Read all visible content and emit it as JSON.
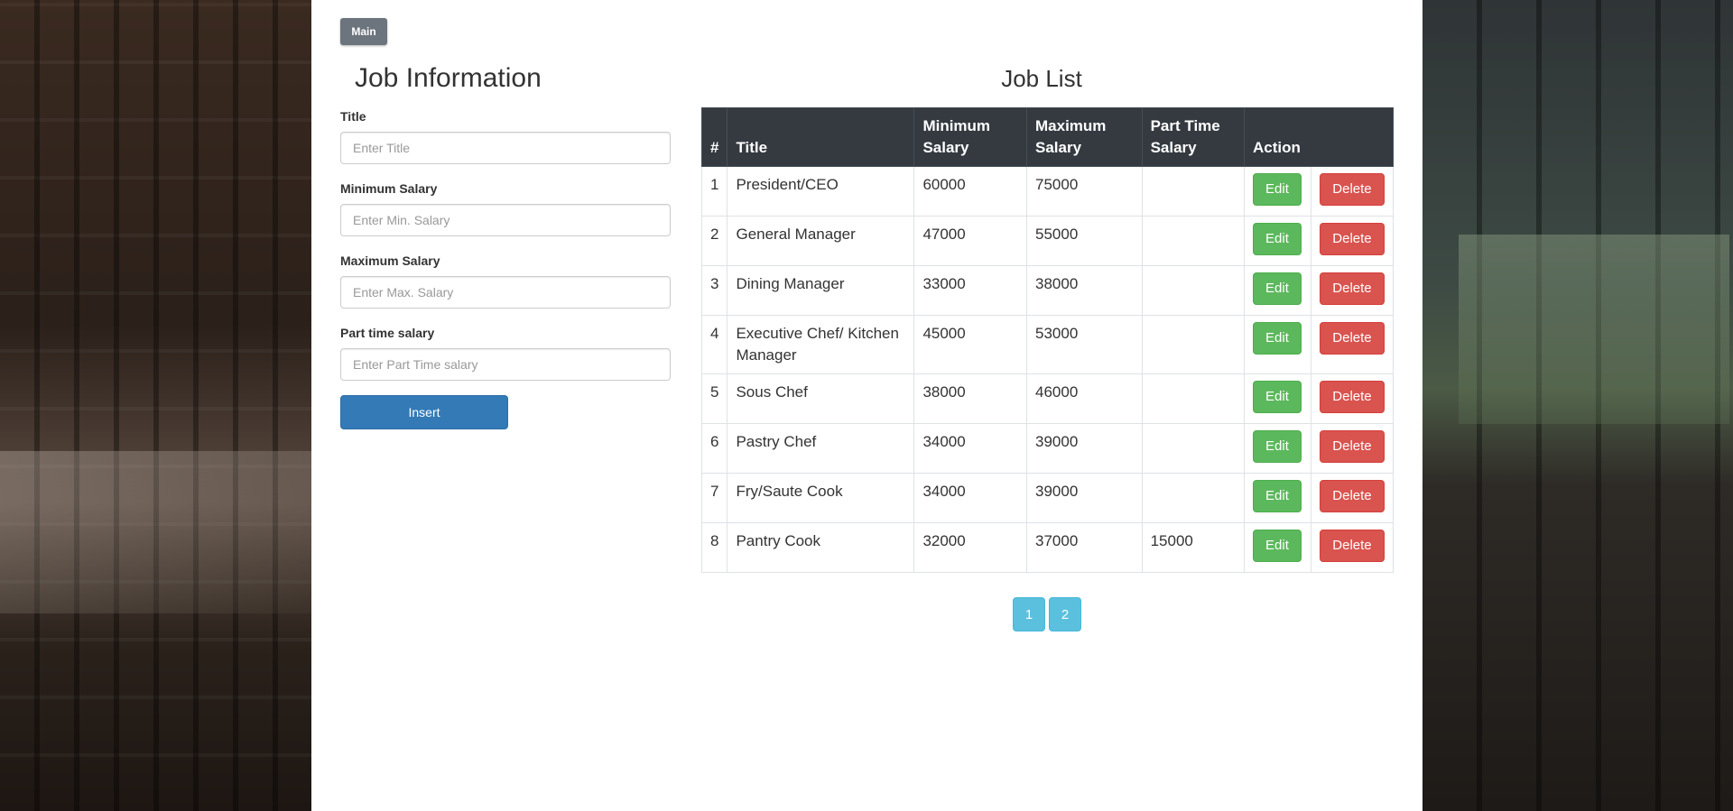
{
  "nav": {
    "main_label": "Main"
  },
  "form": {
    "title": "Job Information",
    "fields": [
      {
        "label": "Title",
        "placeholder": "Enter Title",
        "value": ""
      },
      {
        "label": "Minimum Salary",
        "placeholder": "Enter Min. Salary",
        "value": ""
      },
      {
        "label": "Maximum Salary",
        "placeholder": "Enter Max. Salary",
        "value": ""
      },
      {
        "label": "Part time salary",
        "placeholder": "Enter Part Time salary",
        "value": ""
      }
    ],
    "insert_label": "Insert"
  },
  "list": {
    "title": "Job List",
    "columns": [
      "#",
      "Title",
      "Minimum Salary",
      "Maximum Salary",
      "Part Time Salary",
      "Action"
    ],
    "edit_label": "Edit",
    "delete_label": "Delete",
    "rows": [
      {
        "num": "1",
        "title": "President/CEO",
        "min": "60000",
        "max": "75000",
        "part": ""
      },
      {
        "num": "2",
        "title": "General Manager",
        "min": "47000",
        "max": "55000",
        "part": ""
      },
      {
        "num": "3",
        "title": "Dining Manager",
        "min": "33000",
        "max": "38000",
        "part": ""
      },
      {
        "num": "4",
        "title": "Executive Chef/ Kitchen Manager",
        "min": "45000",
        "max": "53000",
        "part": ""
      },
      {
        "num": "5",
        "title": "Sous Chef",
        "min": "38000",
        "max": "46000",
        "part": ""
      },
      {
        "num": "6",
        "title": "Pastry Chef",
        "min": "34000",
        "max": "39000",
        "part": ""
      },
      {
        "num": "7",
        "title": "Fry/Saute Cook",
        "min": "34000",
        "max": "39000",
        "part": ""
      },
      {
        "num": "8",
        "title": "Pantry Cook",
        "min": "32000",
        "max": "37000",
        "part": "15000"
      }
    ]
  },
  "pagination": {
    "pages": [
      "1",
      "2"
    ]
  },
  "colors": {
    "header_dark": "#343a40",
    "primary": "#337ab7",
    "success": "#5cb85c",
    "danger": "#d9534f",
    "info": "#5bc0de",
    "secondary": "#6c757d"
  }
}
